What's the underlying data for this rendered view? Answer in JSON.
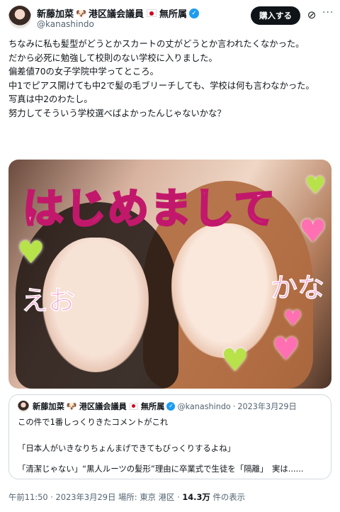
{
  "author": {
    "name": "新藤加菜",
    "name_suffix": "港区議会議員",
    "affiliation": "無所属",
    "handle": "@kanashindo"
  },
  "header": {
    "subscribe_label": "購入する"
  },
  "tweet": {
    "lines": [
      "ちなみに私も髪型がどうとかスカートの丈がどうとか言われたくなかった。",
      "だから必死に勉強して校則のない学校に入りました。",
      "偏差値70の女子学院中学ってところ。",
      "中1でピアス開けても中2で髪の毛ブリーチしても、学校は何も言わなかった。",
      "写真は中2のわたし。",
      "努力してそういう学校選べばよかったんじゃないかな？"
    ]
  },
  "photo": {
    "stamp_text": "はじめまして",
    "scribble_left": "えお",
    "scribble_right": "かな"
  },
  "quote": {
    "handle": "@kanashindo",
    "date": "2023年3月29日",
    "line1": "この件で1番しっくりきたコメントがこれ",
    "line2": "「日本人がいきなりちょんまげできてもびっくりするよね」",
    "line3": "「清潔じゃない」“黒人ルーツの髪形”理由に卒業式で生徒を「隔離」　実は......"
  },
  "footer": {
    "time": "午前11:50",
    "date": "2023年3月29日",
    "location_label": "場所:",
    "location": "東京 港区",
    "views_count": "14.3万",
    "views_label": "件の表示"
  }
}
